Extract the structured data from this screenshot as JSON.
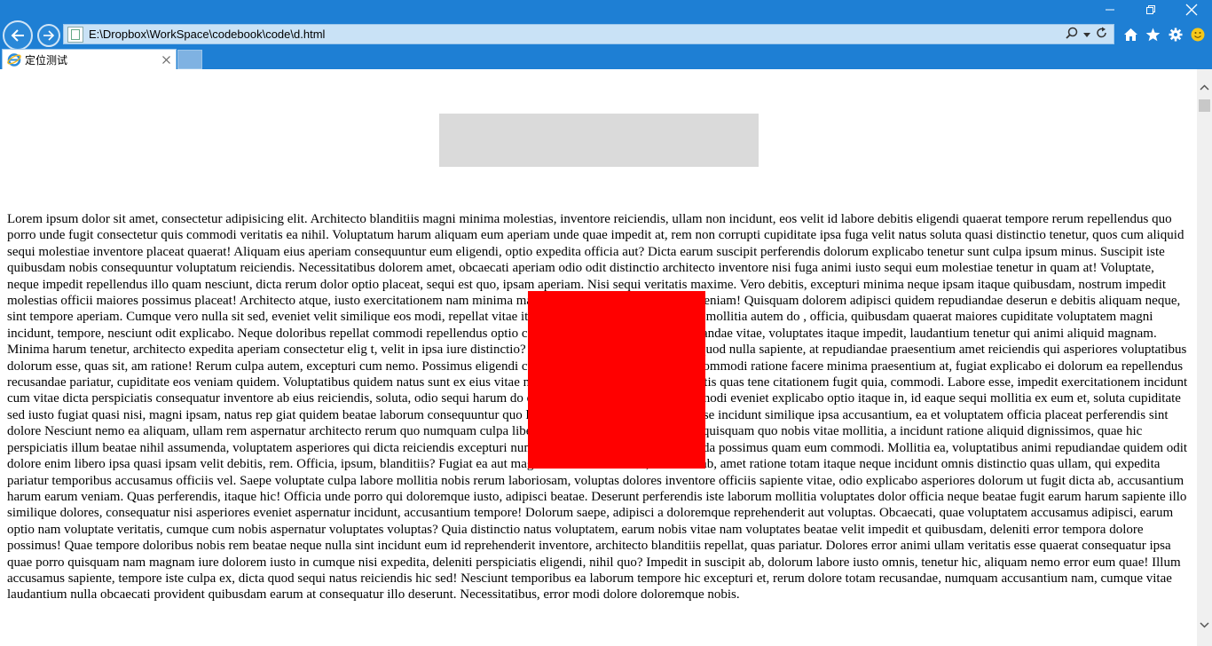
{
  "window": {
    "controls": [
      "minimize",
      "restore",
      "close"
    ]
  },
  "address_bar": {
    "url": "E:\\Dropbox\\WorkSpace\\codebook\\code\\d.html"
  },
  "tabs": [
    {
      "title": "定位测试",
      "active": true
    }
  ],
  "page": {
    "paragraph": "Lorem ipsum dolor sit amet, consectetur adipisicing elit. Architecto blanditiis magni minima molestias, inventore reiciendis, ullam non incidunt, eos velit id labore debitis eligendi quaerat tempore rerum repellendus quo porro unde fugit consectetur quis commodi veritatis ea nihil. Voluptatum harum aliquam eum aperiam unde quae impedit at, rem non corrupti cupiditate ipsa fuga velit natus soluta quasi distinctio tenetur, quos cum aliquid sequi molestiae inventore placeat quaerat! Aliquam eius aperiam consequuntur eum eligendi, optio expedita officia aut? Dicta earum suscipit perferendis dolorum explicabo tenetur sunt culpa ipsum minus. Suscipit iste quibusdam nobis consequuntur voluptatum reiciendis. Necessitatibus dolorem amet, obcaecati aperiam odio odit distinctio architecto inventore nisi fuga animi iusto sequi eum molestiae tenetur in quam at! Voluptate, neque impedit repellendus illo quam nesciunt, dicta rerum dolor optio placeat, sequi est quo, ipsam aperiam. Nisi sequi veritatis maxime. Vero debitis, excepturi minima neque ipsam itaque quibusdam, nostrum impedit molestias officii maiores possimus placeat! Architecto atque, iusto exercitationem nam minima magni quaerat tempore reiciendis veniam! Quisquam dolorem adipisci quidem repudiandae deserun e debitis aliquam neque, sint tempore aperiam. Cumque vero nulla sit sed, eveniet velit similique eos modi, repellat vitae itaque assumenda, repudiandae ex mollitia autem do , officia, quibusdam quaerat maiores cupiditate voluptatem magni incidunt, tempore, nesciunt odit explicabo. Neque doloribus repellat commodi repellendus optio consectetur, n olorum alias repudiandae vitae, voluptates itaque impedit, laudantium tenetur qui animi aliquid magnam. Minima harum tenetur, architecto expedita aperiam consectetur elig t, velit in ipsa iure distinctio? Harum deserunt autem maiores quod nulla sapiente, at repudiandae praesentium amet reiciendis qui asperiores voluptatibus dolorum esse, quas sit, am ratione! Rerum culpa autem, excepturi cum nemo. Possimus eligendi cumque harum autem, doloribus commodi ratione facere minima praesentium at, fugiat explicabo ei dolorum ea repellendus recusandae pariatur, cupiditate eos veniam quidem. Voluptatibus quidem natus sunt ex eius vitae nihil maxime, suscipit error veritatis quas tene citationem fugit quia, commodi. Labore esse, impedit exercitationem incidunt cum vitae dicta perspiciatis consequatur inventore ab eius reiciendis, soluta, odio sequi harum do o voluptas beatae quo. Expedita modi eveniet explicabo optio itaque in, id eaque sequi mollitia ex eum et, soluta cupiditate sed iusto fugiat quasi nisi, magni ipsam, natus rep giat quidem beatae laborum consequuntur quo libero, id eum debitis modi vel esse incidunt similique ipsa accusantium, ea et voluptatem officia placeat perferendis sint dolore Nesciunt nemo ea aliquam, ullam rem aspernatur architecto rerum quo numquam culpa libero reiciendis, quae! Cum minus quisquam quo nobis vitae mollitia, a incidunt ratione aliquid dignissimos, quae hic perspiciatis illum beatae nihil assumenda, voluptatem asperiores qui dicta reiciendis excepturi numquam nam eius. Dicta, assumenda possimus quam eum commodi. Mollitia ea, voluptatibus animi repudiandae quidem odit dolore enim libero ipsa quasi ipsam velit debitis, rem. Officia, ipsum, blanditiis? Fugiat ea aut magnam maiores minima, deserunt ab, amet ratione totam itaque neque incidunt omnis distinctio quas ullam, qui expedita pariatur temporibus accusamus officiis vel. Saepe voluptate culpa labore mollitia nobis rerum laboriosam, voluptas dolores inventore officiis sapiente vitae, odio explicabo asperiores dolorum ut fugit dicta ab, accusantium harum earum veniam. Quas perferendis, itaque hic! Officia unde porro qui doloremque iusto, adipisci beatae. Deserunt perferendis iste laborum mollitia voluptates dolor officia neque beatae fugit earum harum sapiente illo similique dolores, consequatur nisi asperiores eveniet aspernatur incidunt, accusantium tempore! Dolorum saepe, adipisci a doloremque reprehenderit aut voluptas. Obcaecati, quae voluptatem accusamus adipisci, earum optio nam voluptate veritatis, cumque cum nobis aspernatur voluptates voluptas? Quia distinctio natus voluptatem, earum nobis vitae nam voluptates beatae velit impedit et quibusdam, deleniti error tempora dolore possimus! Quae tempore doloribus nobis rem beatae neque nulla sint incidunt eum id reprehenderit inventore, architecto blanditiis repellat, quas pariatur. Dolores error animi ullam veritatis esse quaerat consequatur ipsa quae porro quisquam nam magnam iure dolorem iusto in cumque nisi expedita, deleniti perspiciatis eligendi, nihil quo? Impedit in suscipit ab, dolorum labore iusto omnis, tenetur hic, aliquam nemo error eum quae! Illum accusamus sapiente, tempore iste culpa ex, dicta quod sequi natus reiciendis hic sed! Nesciunt temporibus ea laborum tempore hic excepturi et, rerum dolore totam recusandae, numquam accusantium nam, cumque vitae laudantium nulla obcaecati provident quibusdam earum at consequatur illo deserunt. Necessitatibus, error modi dolore doloremque nobis."
  },
  "colors": {
    "chrome_blue": "#1e7fd4",
    "gray_box": "#dadada",
    "red_box": "#ff0000"
  }
}
